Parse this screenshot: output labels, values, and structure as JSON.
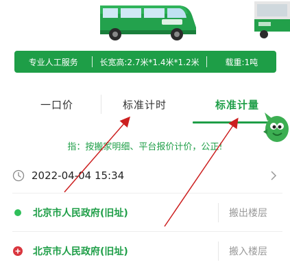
{
  "specs": {
    "service": "专业人工服务",
    "dimensions": "长宽高:2.7米*1.4米*1.2米",
    "load": "载重:1吨"
  },
  "tabs": [
    "一口价",
    "标准计时",
    "标准计量"
  ],
  "active_tab": "标准计量",
  "hint": "指：按搬家明细、平台报价计价，公正!",
  "datetime": "2022-04-04 15:34",
  "route": {
    "from": {
      "address": "北京市人民政府(旧址)",
      "floor_placeholder": "搬出楼层"
    },
    "to": {
      "address": "北京市人民政府(旧址)",
      "floor_placeholder": "搬入楼层"
    }
  },
  "colors": {
    "brand_green": "#1e9e47",
    "annotation_red": "#cc1f1f",
    "destination_red": "#d9363e"
  },
  "icons": [
    "clock-icon",
    "chevron-right-icon",
    "origin-dot-icon",
    "destination-plus-icon",
    "mascot-icon",
    "van-image",
    "truck-image"
  ]
}
